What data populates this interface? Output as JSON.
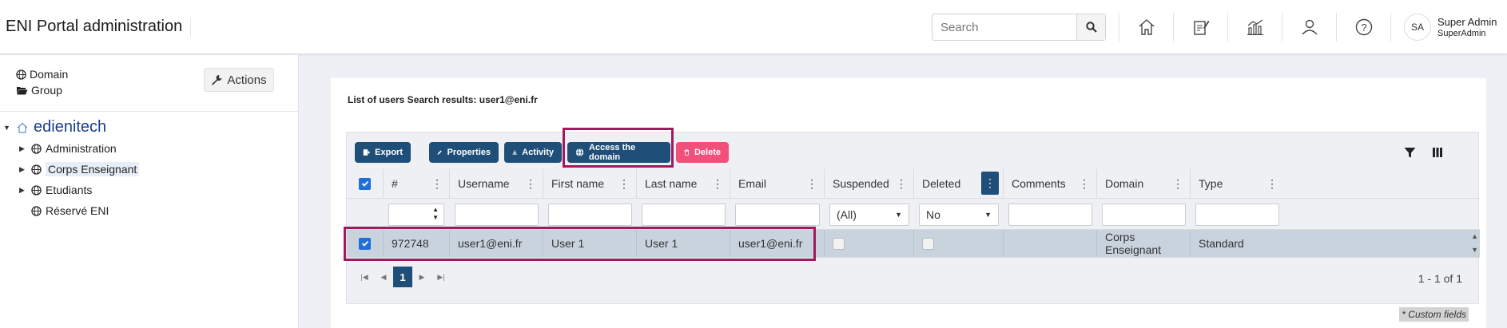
{
  "header": {
    "app_title": "ENI Portal administration",
    "search_placeholder": "Search",
    "user_initials": "SA",
    "user_name": "Super Admin",
    "user_login": "SuperAdmin",
    "icons": [
      "home-icon",
      "edit-icon",
      "chart-icon",
      "user-icon",
      "help-icon"
    ]
  },
  "left_panel": {
    "domain_label": "Domain",
    "group_label": "Group",
    "actions_label": "Actions",
    "tree_root": "edienitech",
    "tree_items": [
      {
        "label": "Administration",
        "expandable": true
      },
      {
        "label": "Corps Enseignant",
        "expandable": true,
        "selected": true
      },
      {
        "label": "Etudiants",
        "expandable": true
      },
      {
        "label": "Réservé ENI",
        "expandable": false
      }
    ]
  },
  "main": {
    "title_prefix": "List of users Search results: ",
    "title_query": "user1@eni.fr",
    "toolbar": {
      "export": "Export",
      "properties": "Properties",
      "activity": "Activity",
      "access_domain": "Access the domain",
      "delete": "Delete"
    },
    "columns": [
      "#",
      "Username",
      "First name",
      "Last name",
      "Email",
      "Suspended",
      "Deleted",
      "Comments",
      "Domain",
      "Type"
    ],
    "filters": {
      "suspended": "(All)",
      "deleted": "No"
    },
    "rows": [
      {
        "id": "972748",
        "username": "user1@eni.fr",
        "first_name": "User 1",
        "last_name": "User 1",
        "email": "user1@eni.fr",
        "suspended": false,
        "deleted": false,
        "comments": "",
        "domain": "Corps Enseignant",
        "type": "Standard"
      }
    ],
    "pager": {
      "current_page": "1",
      "info": "1 - 1 of 1"
    },
    "custom_fields_note": "* Custom fields"
  },
  "colors": {
    "primary": "#1f4e79",
    "danger": "#f0507a",
    "highlight": "#a3185f",
    "checkbox": "#1f6fd8"
  }
}
